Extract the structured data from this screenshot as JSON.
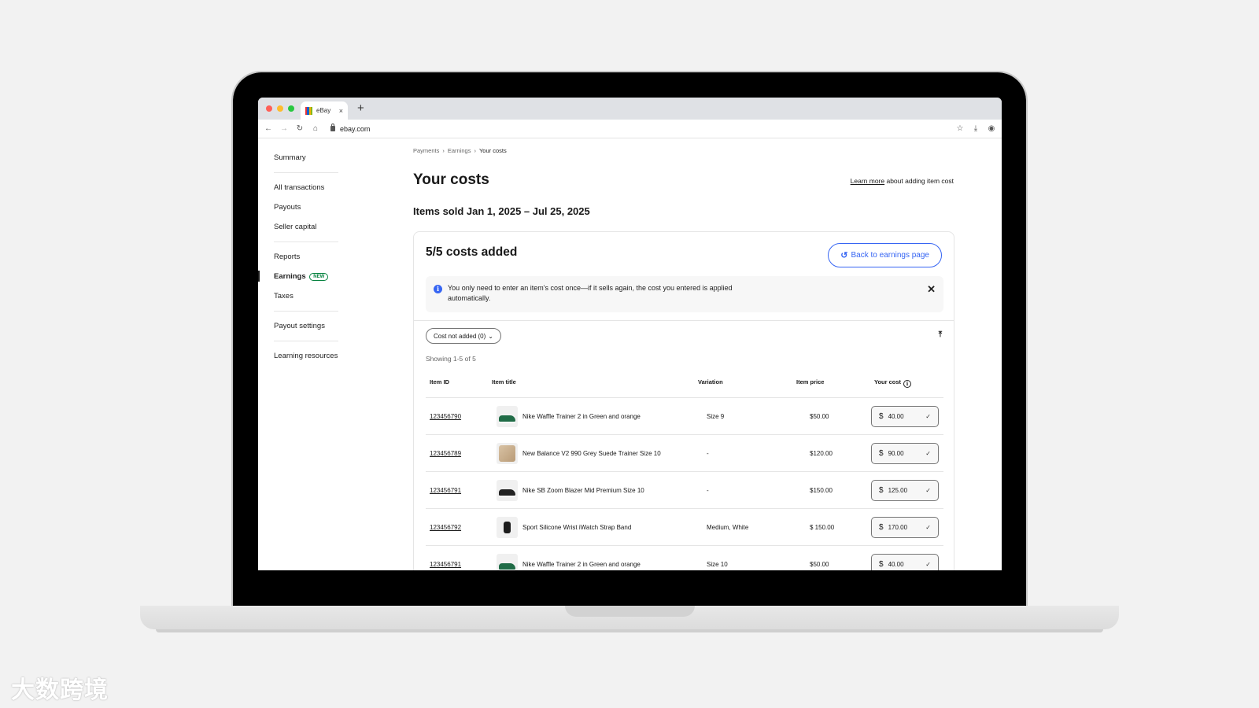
{
  "browser": {
    "tab_title": "eBay",
    "tab_close": "×",
    "new_tab": "+",
    "url": "ebay.com"
  },
  "sidebar": {
    "items": [
      {
        "label": "Summary"
      },
      {
        "label": "All transactions"
      },
      {
        "label": "Payouts"
      },
      {
        "label": "Seller capital"
      },
      {
        "label": "Reports"
      },
      {
        "label": "Earnings",
        "badge": "NEW",
        "active": true
      },
      {
        "label": "Taxes"
      },
      {
        "label": "Payout settings"
      },
      {
        "label": "Learning resources"
      }
    ]
  },
  "breadcrumb": [
    "Payments",
    "Earnings",
    "Your costs"
  ],
  "page": {
    "title": "Your costs",
    "learn_more_link": "Learn more",
    "learn_more_rest": " about adding item cost",
    "date_range": "Items sold Jan 1, 2025 – Jul 25, 2025"
  },
  "card": {
    "title": "5/5 costs added",
    "back_button": "Back to earnings page",
    "info_text": "You only need to enter an item's cost once—if it sells again, the cost you entered is applied automatically.",
    "filter_chip": "Cost not added (0)",
    "showing": "Showing 1-5 of 5"
  },
  "table": {
    "headers": {
      "item_id": "Item ID",
      "item_title": "Item title",
      "variation": "Variation",
      "item_price": "Item price",
      "your_cost": "Your cost"
    },
    "rows": [
      {
        "id": "123456790",
        "title": "Nike Waffle Trainer 2  in Green and orange",
        "variation": "Size 9",
        "price": "$50.00",
        "cost": "40.00",
        "thumb": "green-shoe"
      },
      {
        "id": "123456789",
        "title": "New Balance V2 990 Grey Suede Trainer Size 10",
        "variation": "-",
        "price": "$120.00",
        "cost": "90.00",
        "thumb": "nb-shoe"
      },
      {
        "id": "123456791",
        "title": "Nike SB Zoom Blazer Mid Premium Size 10",
        "variation": "-",
        "price": "$150.00",
        "cost": "125.00",
        "thumb": "black-shoe"
      },
      {
        "id": "123456792",
        "title": "Sport Silicone Wrist iWatch Strap Band",
        "variation": "Medium, White",
        "price": "$ 150.00",
        "cost": "170.00",
        "thumb": "watch-strap"
      },
      {
        "id": "123456791",
        "title": "Nike Waffle Trainer 2  in Green and orange",
        "variation": "Size 10",
        "price": "$50.00",
        "cost": "40.00",
        "thumb": "green-shoe"
      }
    ],
    "currency_symbol": "$"
  },
  "watermark": "大数跨境",
  "colors": {
    "accent_blue": "#3665f3",
    "new_badge_green": "#05823f"
  }
}
